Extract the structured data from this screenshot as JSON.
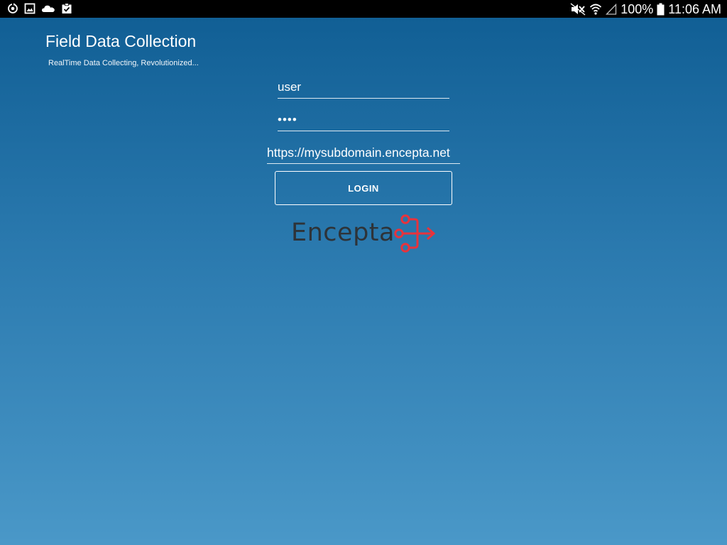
{
  "status_bar": {
    "left_icons": [
      "sync-icon",
      "image-icon",
      "cloud-icon",
      "clipboard-check-icon"
    ],
    "right_icons": [
      "mute-icon",
      "wifi-icon",
      "signal-icon",
      "battery-icon"
    ],
    "battery_level": "100%",
    "time": "11:06 AM"
  },
  "app": {
    "title": "Field Data Collection",
    "subtitle": "RealTime Data Collecting, Revolutionized..."
  },
  "login_form": {
    "username_value": "user",
    "password_value": "••••",
    "server_value": "https://mysubdomain.encepta.net",
    "login_label": "LOGIN"
  },
  "logo": {
    "text": "Encepta",
    "text_color": "#2e3338",
    "mark_color": "#e8333c"
  },
  "colors": {
    "background_top": "#0f5d93",
    "background_bottom": "#4a98c8",
    "status_bar": "#000000"
  }
}
